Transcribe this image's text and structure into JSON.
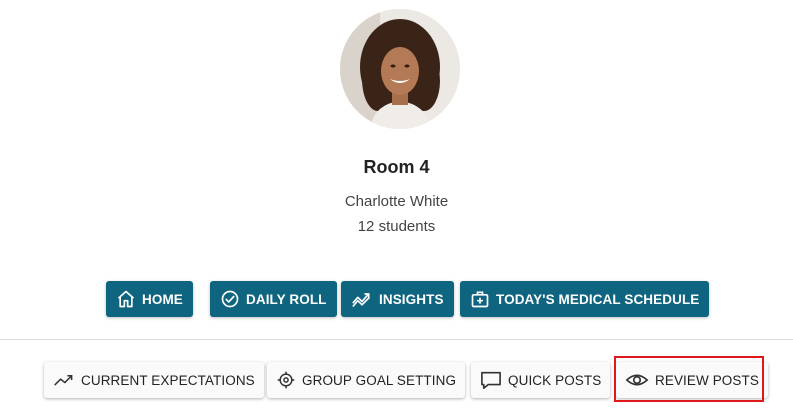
{
  "profile": {
    "room_title": "Room 4",
    "teacher_name": "Charlotte White",
    "student_count": "12 students"
  },
  "primary_actions": [
    {
      "label": "HOME",
      "icon": "home-icon"
    },
    {
      "label": "DAILY ROLL",
      "icon": "check-circle-icon"
    },
    {
      "label": "INSIGHTS",
      "icon": "insights-icon"
    },
    {
      "label": "TODAY'S MEDICAL SCHEDULE",
      "icon": "medical-kit-icon"
    }
  ],
  "secondary_actions": [
    {
      "label": "CURRENT EXPECTATIONS",
      "icon": "trending-up-icon"
    },
    {
      "label": "GROUP GOAL SETTING",
      "icon": "target-icon"
    },
    {
      "label": "QUICK POSTS",
      "icon": "comment-icon"
    },
    {
      "label": "REVIEW POSTS",
      "icon": "eye-icon",
      "highlighted": true
    }
  ],
  "colors": {
    "primary_button": "#0f6480",
    "highlight": "#e0181b"
  }
}
